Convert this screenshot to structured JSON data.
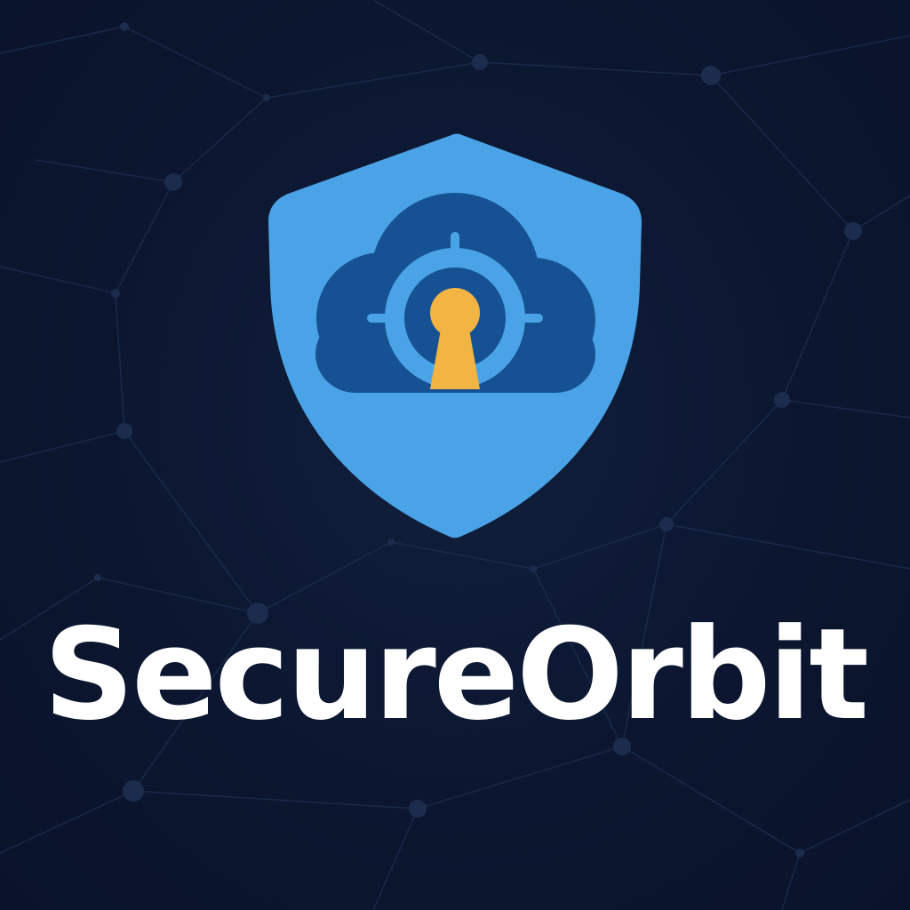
{
  "brand": {
    "name": "SecureOrbit"
  },
  "logo": {
    "icon": "shield-cloud-keyhole-icon",
    "shield_color": "#4aa3e6",
    "cloud_color": "#165293",
    "ring_color": "#4aa3e6",
    "keyhole_color": "#f2b544"
  },
  "background": {
    "color": "#0d1730",
    "decoration": "network-lines",
    "line_color": "#1b2c4d"
  }
}
